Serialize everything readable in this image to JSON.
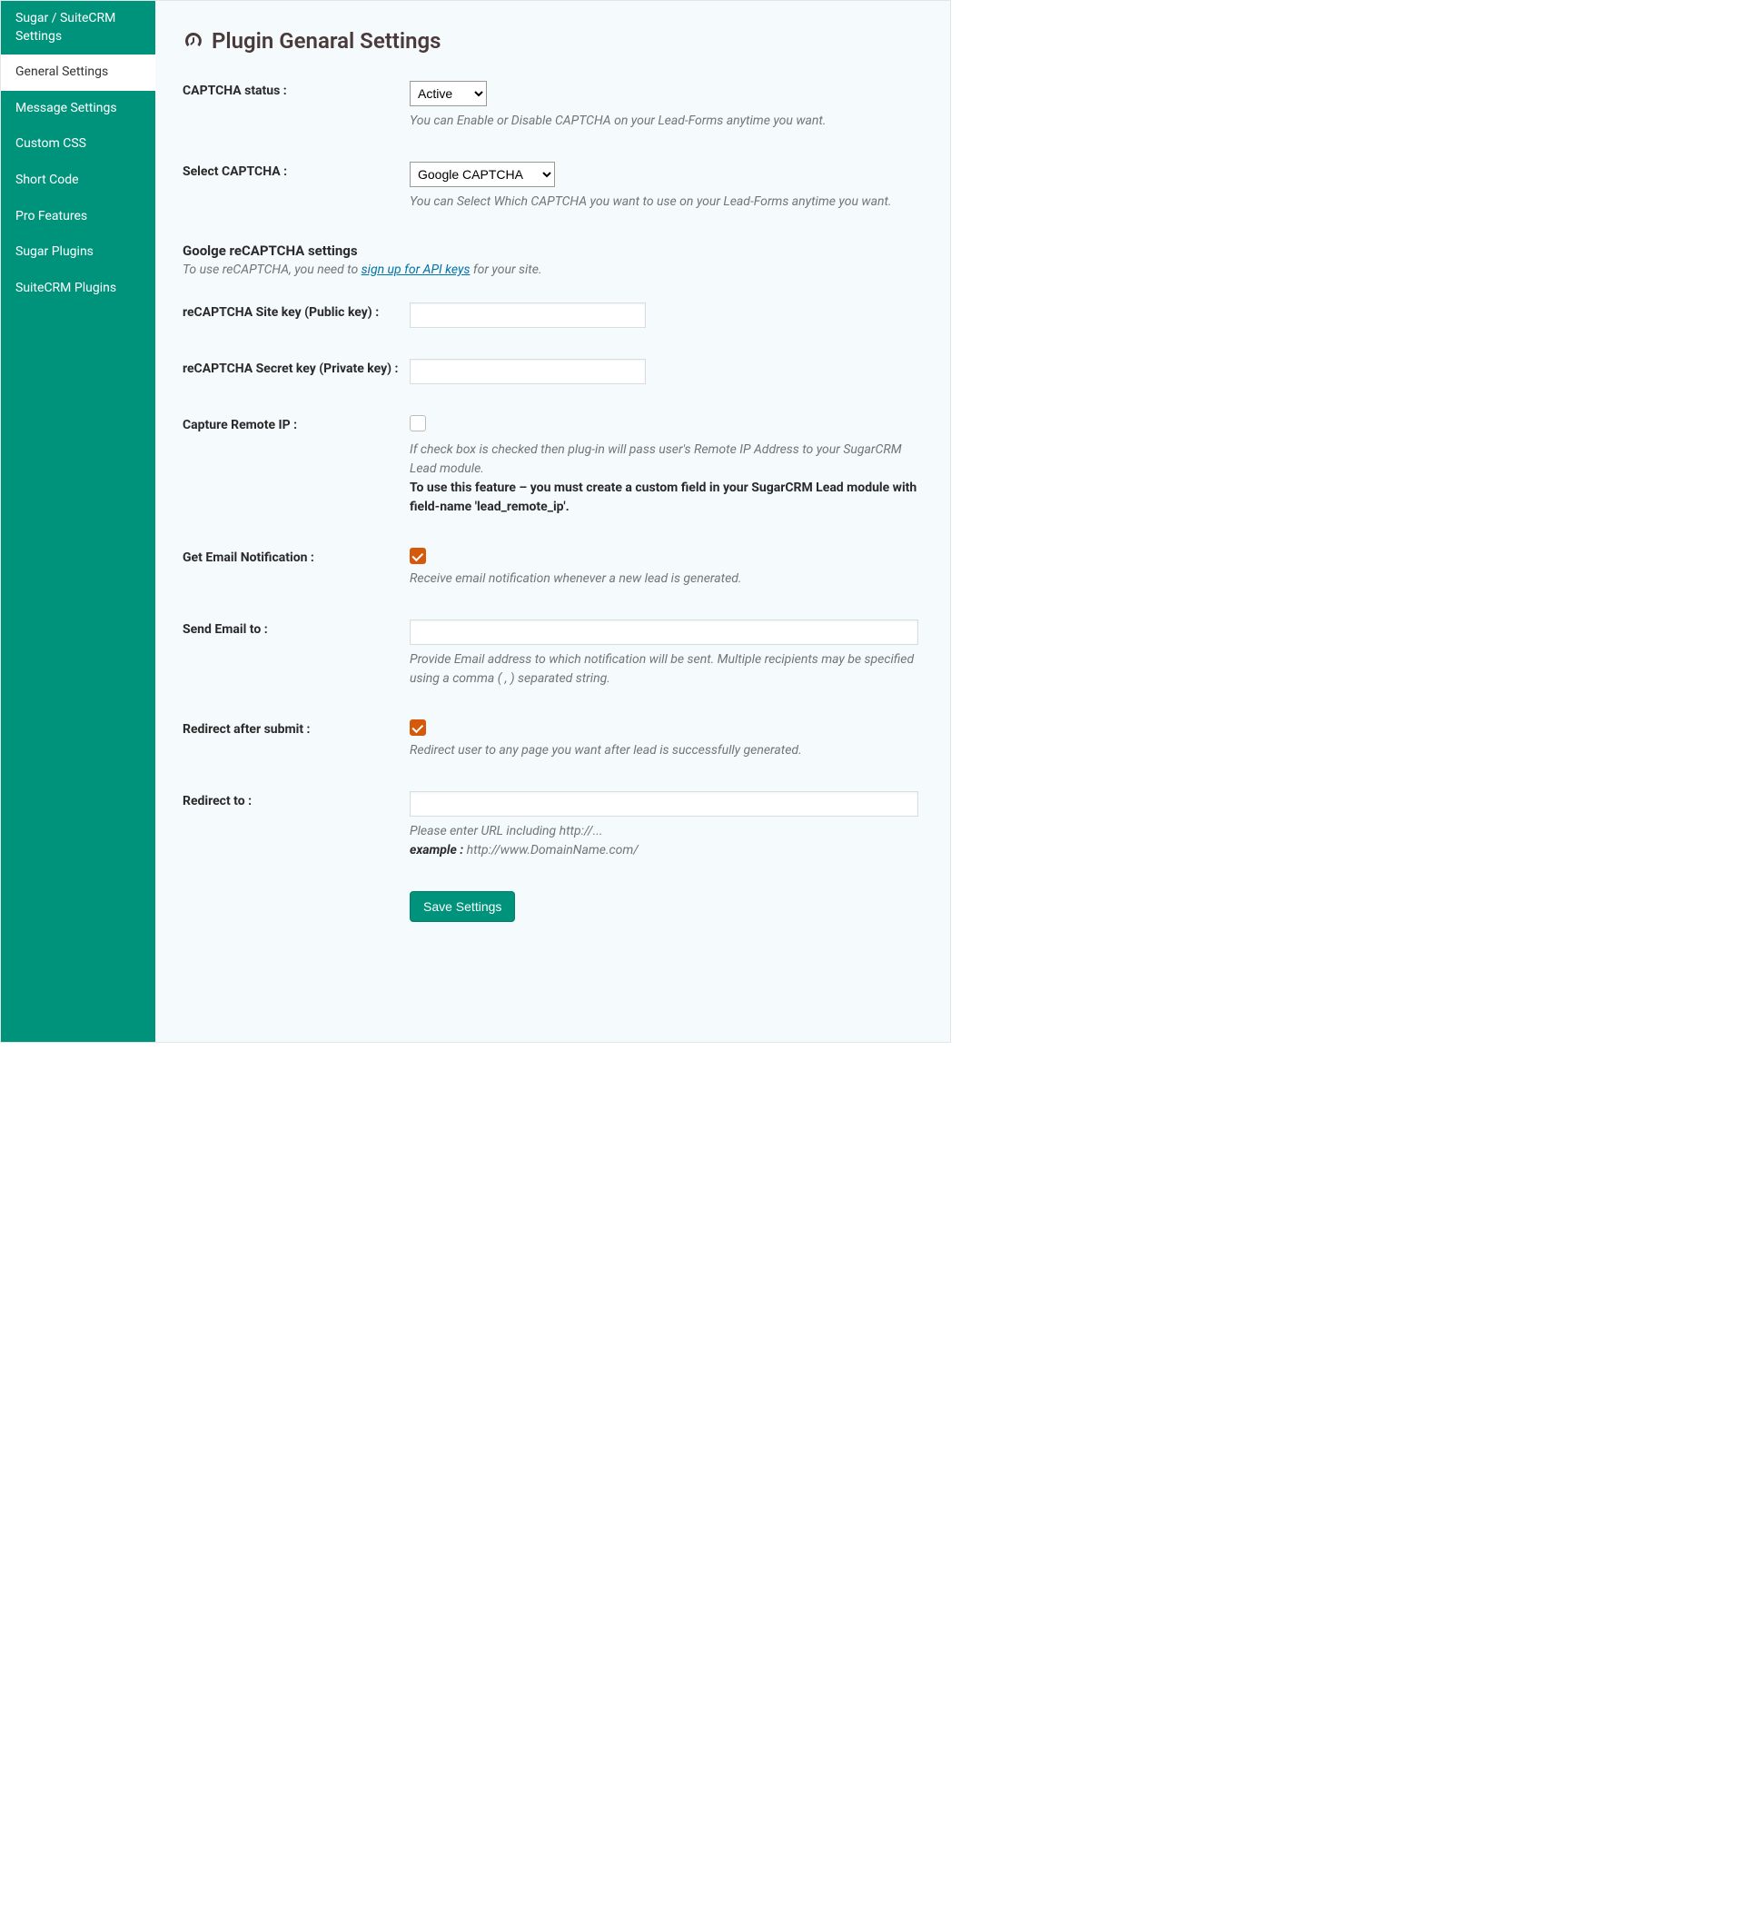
{
  "sidebar": {
    "items": [
      {
        "label": "Sugar / SuiteCRM Settings",
        "active": false
      },
      {
        "label": "General Settings",
        "active": true
      },
      {
        "label": "Message Settings",
        "active": false
      },
      {
        "label": "Custom CSS",
        "active": false
      },
      {
        "label": "Short Code",
        "active": false
      },
      {
        "label": "Pro Features",
        "active": false
      },
      {
        "label": "Sugar Plugins",
        "active": false
      },
      {
        "label": "SuiteCRM Plugins",
        "active": false
      }
    ]
  },
  "page": {
    "title": "Plugin Genaral Settings"
  },
  "form": {
    "captcha_status": {
      "label": "CAPTCHA status :",
      "value": "Active",
      "help": "You can Enable or Disable CAPTCHA on your Lead-Forms anytime you want."
    },
    "select_captcha": {
      "label": "Select CAPTCHA :",
      "value": "Google CAPTCHA",
      "help": "You can Select Which CAPTCHA you want to use on your Lead-Forms anytime you want."
    },
    "recaptcha_section": {
      "heading": "Goolge reCAPTCHA settings",
      "sub_prefix": "To use reCAPTCHA, you need to ",
      "sub_link": "sign up for API keys",
      "sub_suffix": " for your site."
    },
    "site_key": {
      "label": "reCAPTCHA Site key (Public key) :",
      "value": ""
    },
    "secret_key": {
      "label": "reCAPTCHA Secret key (Private key) :",
      "value": ""
    },
    "capture_ip": {
      "label": "Capture Remote IP :",
      "checked": false,
      "help": "If check box is checked then plug-in will pass user's Remote IP Address to your SugarCRM Lead module.",
      "help_strong": "To use this feature – you must create a custom field in your SugarCRM Lead module with field-name 'lead_remote_ip'."
    },
    "email_notify": {
      "label": "Get Email Notification :",
      "checked": true,
      "help": "Receive email notification whenever a new lead is generated."
    },
    "send_email_to": {
      "label": "Send Email to :",
      "value": "",
      "help": "Provide Email address to which notification will be sent. Multiple recipients may be specified using a comma ( , ) separated string."
    },
    "redirect_after": {
      "label": "Redirect after submit :",
      "checked": true,
      "help": "Redirect user to any page you want after lead is successfully generated."
    },
    "redirect_to": {
      "label": "Redirect to :",
      "value": "",
      "help1": "Please enter URL including http://...",
      "example_label": "example :",
      "example_value": " http://www.DomainName.com/"
    },
    "save_label": "Save Settings"
  }
}
